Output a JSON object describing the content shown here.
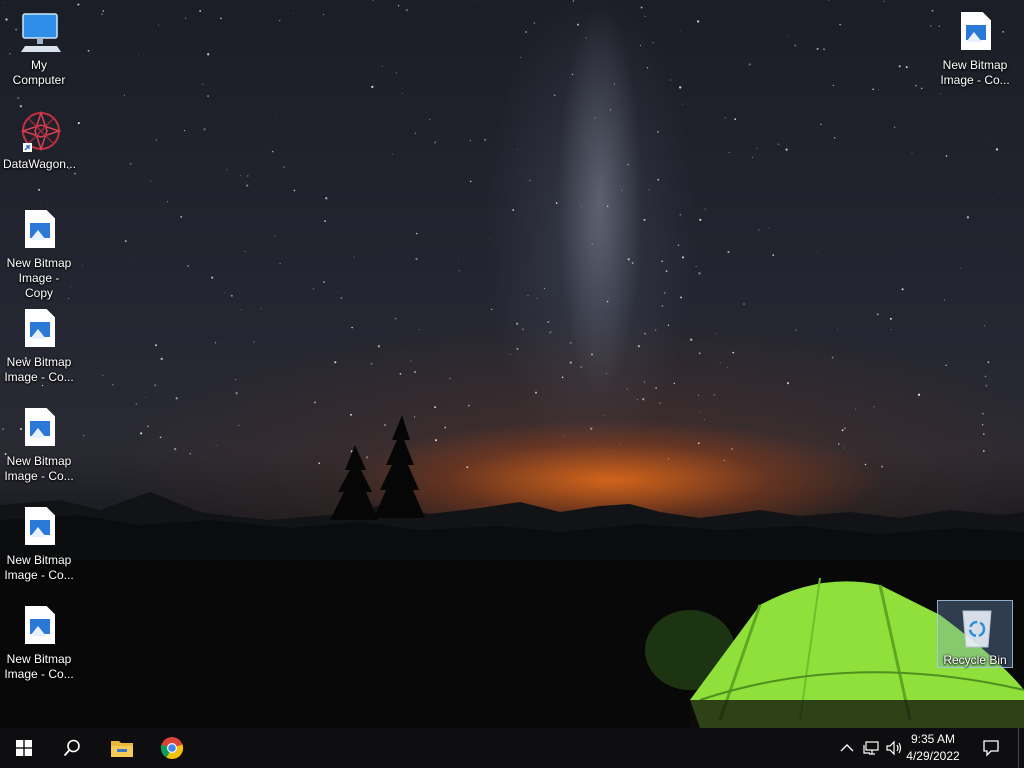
{
  "desktop": {
    "icons": [
      {
        "label": "My Computer",
        "icon": "computer-icon"
      },
      {
        "label": "DataWagon...",
        "icon": "datawagon-icon"
      },
      {
        "label": "New Bitmap Image - Copy",
        "icon": "bitmap-file-icon"
      },
      {
        "label": "New Bitmap Image - Co...",
        "icon": "bitmap-file-icon"
      },
      {
        "label": "New Bitmap Image - Co...",
        "icon": "bitmap-file-icon"
      },
      {
        "label": "New Bitmap Image - Co...",
        "icon": "bitmap-file-icon"
      },
      {
        "label": "New Bitmap Image - Co...",
        "icon": "bitmap-file-icon"
      },
      {
        "label": "New Bitmap Image - Co...",
        "icon": "bitmap-file-icon"
      },
      {
        "label": "Recycle Bin",
        "icon": "recycle-bin-icon"
      }
    ]
  },
  "taskbar": {
    "pinned": [
      {
        "name": "start",
        "icon": "windows-logo-icon"
      },
      {
        "name": "search",
        "icon": "search-icon"
      },
      {
        "name": "file-explorer",
        "icon": "folder-icon"
      },
      {
        "name": "chrome",
        "icon": "chrome-icon"
      }
    ],
    "tray": {
      "icons": [
        "chevron-up-icon",
        "network-icon",
        "volume-icon"
      ],
      "time": "9:35 AM",
      "date": "4/29/2022",
      "notification_icon": "action-center-icon"
    }
  },
  "colors": {
    "taskbar": "#0e0e10",
    "tent": "#8fe03a",
    "selection": "#78a0d2",
    "bitmap_blue": "#2a79d6"
  }
}
